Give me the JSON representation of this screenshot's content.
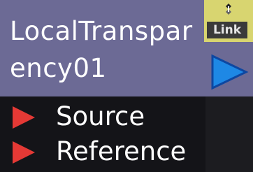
{
  "node": {
    "title": "LocalTransparency01",
    "link_label": "Link",
    "ports": [
      {
        "label": "Source"
      },
      {
        "label": "Reference"
      }
    ]
  },
  "colors": {
    "header": "#6c6a95",
    "body": "#141418",
    "link_box": "#d8d570",
    "expand_arrow": "#1e88e5",
    "port_arrow": "#e53935"
  },
  "icons": {
    "link": "link-icon",
    "expand": "expand-arrow-icon",
    "port": "input-port-arrow-icon"
  }
}
